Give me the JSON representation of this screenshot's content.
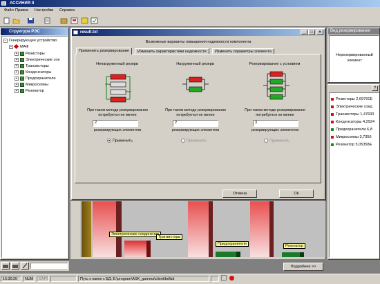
{
  "app": {
    "title": "АССИНИЯ II"
  },
  "menu": [
    "Файл",
    "Правка",
    "Настройки",
    "Справка"
  ],
  "tree": {
    "title": "Структура РЭС",
    "root": "Генерирующее устройство",
    "child": "МАФ",
    "items": [
      "Резисторы",
      "Электрические сое",
      "Транзисторы",
      "Конденсаторы",
      "Предохранители",
      "Микросхемы",
      "Резонатор"
    ]
  },
  "dialog": {
    "title": "result.txt",
    "caption": "Возможные варианты повышения надежности компонента",
    "tabs": [
      "Применить резервирование",
      "Изменить характеристики надежности",
      "Изменить параметры элемента"
    ],
    "columns": [
      {
        "heading": "Ненагруженный резерв",
        "text1": "При таком методе резервирования",
        "text2": "потребуется не менее",
        "value": "2",
        "text3": "резервирующих элементов",
        "radio": "Применить",
        "enabled": true,
        "selected": true
      },
      {
        "heading": "Нагруженный резерв",
        "text1": "При таком методе резервирования",
        "text2": "потребуется не менее",
        "value": "2",
        "text3": "резервирующих элементов",
        "radio": "Применить",
        "enabled": false,
        "selected": false
      },
      {
        "heading": "Резервирование с условием",
        "text1": "При таком методе резервирования",
        "text2": "потребуется не менее",
        "value": "3",
        "text3": "резервирующих элементов",
        "radio": "Применить",
        "enabled": false,
        "selected": false
      }
    ],
    "cancel": "Отмена",
    "ok": "Ok"
  },
  "right_panel": {
    "title": "Вид резервирования",
    "status": "Нерезервированный элемент",
    "legend": [
      {
        "label": "Резисторы 2,69791Е",
        "color": "#cc1111"
      },
      {
        "label": "Электрические соед",
        "color": "#cc1111"
      },
      {
        "label": "Транзисторы 1,47600",
        "color": "#cc1111"
      },
      {
        "label": "Конденсаторы 4,2924",
        "color": "#cc1111"
      },
      {
        "label": "Предохранители 6,8",
        "color": "#1a8a1a"
      },
      {
        "label": "Микросхемы 3,7356",
        "color": "#cc1111"
      },
      {
        "label": "Резонатор 5,05358Е",
        "color": "#1a8a1a"
      }
    ]
  },
  "chart": {
    "labels": [
      "Электрические соединения",
      "Транзисторы",
      "Предохранители",
      "Резонатор"
    ],
    "more_button": "Подробнее >>"
  },
  "status": {
    "time": "16:30:20",
    "num": "NUM",
    "caps": "CAPS",
    "path": "Путь к папке с БД: E:\\program\\ASK_gamma\\client\\bd\\bd"
  }
}
